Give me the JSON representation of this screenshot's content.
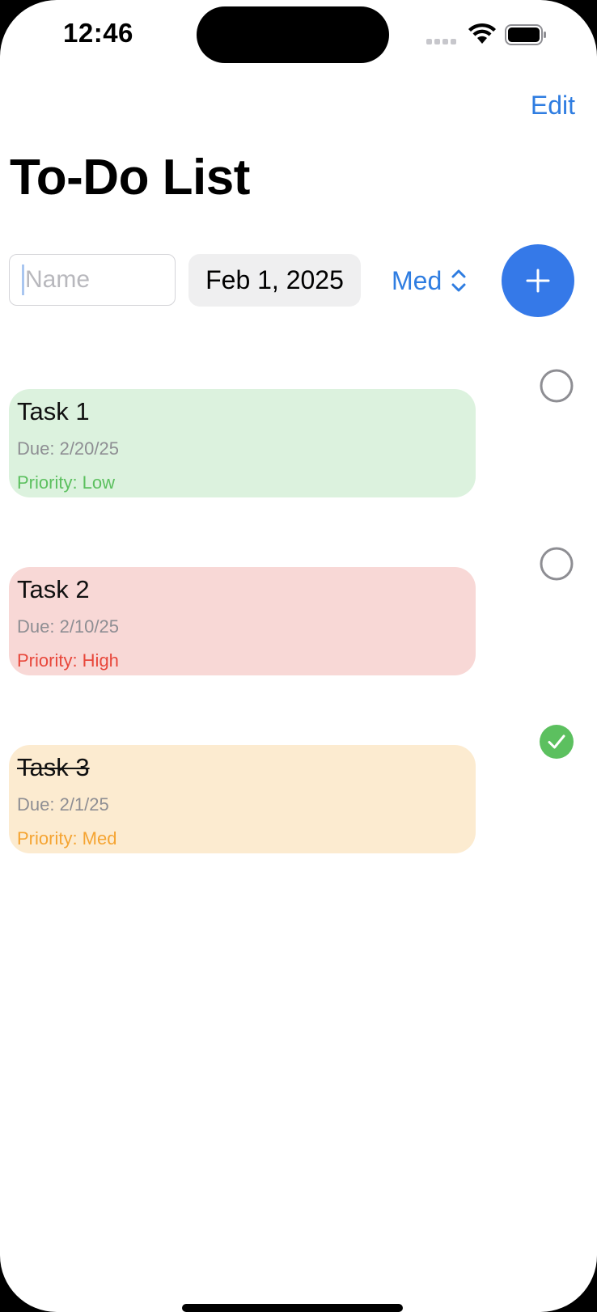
{
  "status_bar": {
    "time": "12:46"
  },
  "nav": {
    "edit_label": "Edit",
    "title": "To-Do List"
  },
  "form": {
    "name_placeholder": "Name",
    "name_value": "",
    "date_value": "Feb 1, 2025",
    "priority_value": "Med"
  },
  "colors": {
    "accent": "#2f7de1",
    "add_button": "#3579e8",
    "low_bg": "#dcf2de",
    "low_text": "#5cc05f",
    "high_bg": "#f8d8d6",
    "high_text": "#e8473b",
    "med_bg": "#fcebd0",
    "med_text": "#f5a432",
    "check_done": "#5cc05f"
  },
  "tasks": [
    {
      "name": "Task 1",
      "due": "Due: 2/20/25",
      "priority": "Priority: Low",
      "completed": false
    },
    {
      "name": "Task 2",
      "due": "Due: 2/10/25",
      "priority": "Priority: High",
      "completed": false
    },
    {
      "name": "Task 3",
      "due": "Due: 2/1/25",
      "priority": "Priority: Med",
      "completed": true
    }
  ]
}
